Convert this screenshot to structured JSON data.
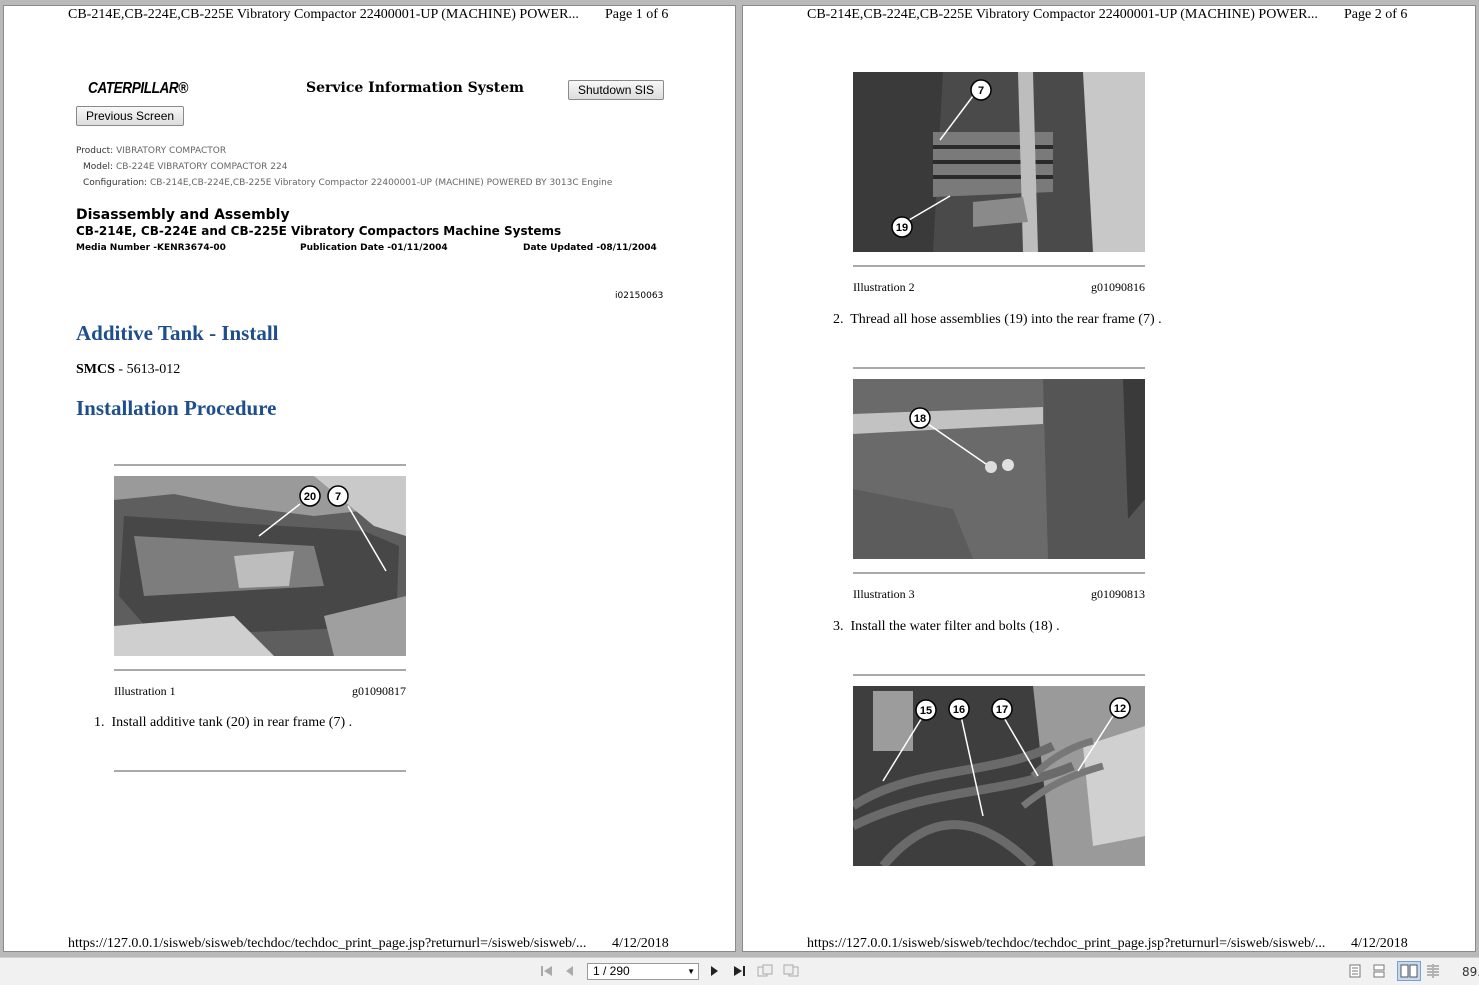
{
  "doc_header": "CB-214E,CB-224E,CB-225E Vibratory Compactor 22400001-UP (MACHINE) POWER...",
  "pages": [
    {
      "page_label": "Page 1 of 6",
      "footer_url": "https://127.0.0.1/sisweb/sisweb/techdoc/techdoc_print_page.jsp?returnurl=/sisweb/sisweb/...",
      "footer_date": "4/12/2018"
    },
    {
      "page_label": "Page 2 of 6",
      "footer_url": "https://127.0.0.1/sisweb/sisweb/techdoc/techdoc_print_page.jsp?returnurl=/sisweb/sisweb/...",
      "footer_date": "4/12/2018"
    }
  ],
  "sis": {
    "logo": "CATERPILLAR®",
    "title": "Service Information System",
    "shutdown_button": "Shutdown SIS",
    "previous_button": "Previous Screen"
  },
  "meta": {
    "product_label": "Product:",
    "product_value": "VIBRATORY COMPACTOR",
    "model_label": "Model:",
    "model_value": "CB-224E VIBRATORY COMPACTOR 224",
    "config_label": "Configuration:",
    "config_value": "CB-214E,CB-224E,CB-225E Vibratory Compactor 22400001-UP (MACHINE) POWERED BY 3013C Engine"
  },
  "doc": {
    "section": "Disassembly and Assembly",
    "subtitle": "CB-214E, CB-224E and CB-225E Vibratory Compactors Machine Systems",
    "media_number": "Media Number -KENR3674-00",
    "publication_date": "Publication Date -01/11/2004",
    "date_updated": "Date Updated -08/11/2004",
    "doc_id": "i02150063",
    "title": "Additive Tank - Install",
    "smcs_label": "SMCS",
    "smcs_value": " - 5613-012",
    "procedure_title": "Installation Procedure"
  },
  "illustrations": [
    {
      "label": "Illustration 1",
      "code": "g01090817",
      "callouts": [
        "20",
        "7"
      ]
    },
    {
      "label": "Illustration 2",
      "code": "g01090816",
      "callouts": [
        "7",
        "19"
      ]
    },
    {
      "label": "Illustration 3",
      "code": "g01090813",
      "callouts": [
        "18"
      ]
    },
    {
      "label": "",
      "code": "",
      "callouts": [
        "15",
        "16",
        "17",
        "12"
      ]
    }
  ],
  "steps": [
    {
      "num": "1.",
      "text": "Install additive tank (20) in rear frame (7) ."
    },
    {
      "num": "2.",
      "text": "Thread all hose assemblies (19) into the rear frame (7) ."
    },
    {
      "num": "3.",
      "text": "Install the water filter and bolts (18) ."
    }
  ],
  "toolbar": {
    "page_value": "1 / 290",
    "zoom": "89."
  }
}
